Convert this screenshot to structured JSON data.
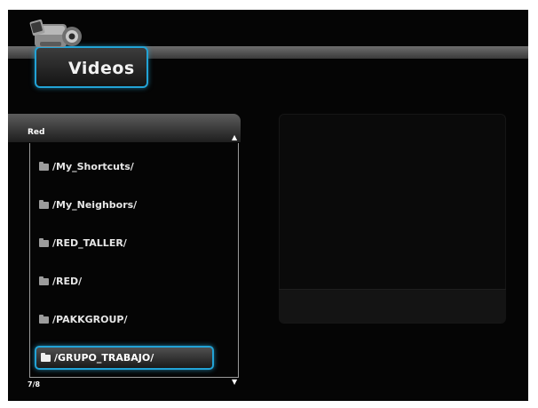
{
  "header": {
    "title": "Videos",
    "icon": "video-camera-icon"
  },
  "browser": {
    "panel_title": "Red",
    "items": [
      {
        "label": "/My_Shortcuts/",
        "icon": "folder-icon"
      },
      {
        "label": "/My_Neighbors/",
        "icon": "folder-icon"
      },
      {
        "label": "/RED_TALLER/",
        "icon": "folder-icon"
      },
      {
        "label": "/RED/",
        "icon": "folder-icon"
      },
      {
        "label": "/PAKKGROUP/",
        "icon": "folder-icon"
      },
      {
        "label": "/GRUPO_TRABAJO/",
        "icon": "folder-icon",
        "selected": true
      }
    ],
    "page_indicator": "7/8",
    "scroll_up_icon": "▲",
    "scroll_down_icon": "▼"
  },
  "colors": {
    "accent": "#22a3d6",
    "background": "#050505"
  }
}
